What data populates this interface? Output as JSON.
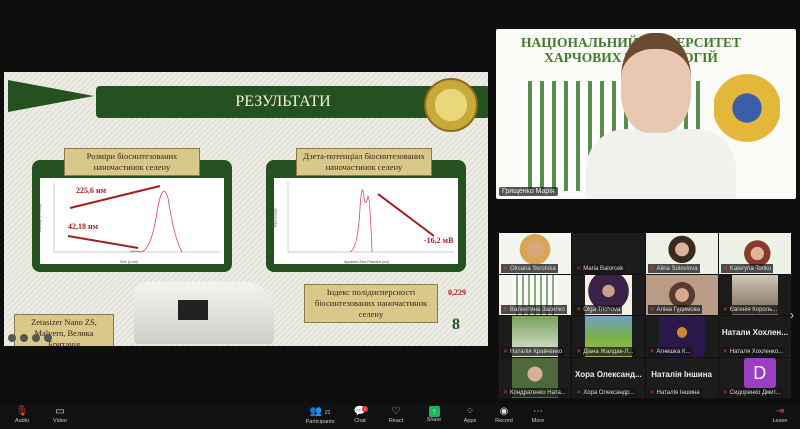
{
  "slide": {
    "title": "РЕЗУЛЬТАТИ",
    "panel_left_label": "Розміри біосинтезованих наночастинок селену",
    "panel_right_label": "Дзета-потенціал біосинтезованих наночастинок селену",
    "size_peak_1": "225,6 нм",
    "size_peak_2": "42,18 нм",
    "zeta_value": "-16,2 мВ",
    "pdi_label": "Індекс полідисперсності біосинтезованих наночастинок селену",
    "pdi_value": "0,229",
    "instrument_label": "Zetasizer Nano ZS, Malvern, Велика Британія",
    "page_number": "8",
    "left_xlabel": "Size (d.nm)",
    "left_ylabel": "Intensity (Percent)",
    "right_xlabel": "Apparent Zeta Potential (mV)",
    "right_ylabel": "Total Counts"
  },
  "speaker": {
    "name": "Грищенко Марія",
    "background_text": "НАЦІОНАЛЬНИЙ УНІВЕРСИТЕТ ХАРЧОВИХ ТЕХНОЛОГІЙ"
  },
  "participants": [
    {
      "name": "Oksana Skrotska"
    },
    {
      "name": "Maria Balorcek"
    },
    {
      "name": "Alina Soloviova"
    },
    {
      "name": "Kateryna Tonko"
    },
    {
      "name": "Валентина Засилко"
    },
    {
      "name": "Olga Trichova"
    },
    {
      "name": "Аліна Гудимова"
    },
    {
      "name": "Євгенія Король..."
    },
    {
      "name": "Наталія Кравченко"
    },
    {
      "name": "Діана Жалдак-Л..."
    },
    {
      "name": "Агнешка К..."
    },
    {
      "name": "Наталя Хохленко...",
      "display": "Натали Хохлен..."
    },
    {
      "name": "Кондратенко Ната..."
    },
    {
      "name": "Хора Олександр...",
      "display": "Хора Олександ..."
    },
    {
      "name": "Наталія Іншина",
      "display": "Наталія Іншина"
    },
    {
      "name": "Сидоренко Дмит...",
      "initial": "D"
    }
  ],
  "toolbar": {
    "audio": "Audio",
    "video": "Video",
    "participants": "Participants",
    "participants_count": "21",
    "chat": "Chat",
    "chat_badge": "1",
    "react": "React",
    "share": "Share",
    "apps": "Apps",
    "record": "Record",
    "more": "More",
    "leave": "Leave"
  }
}
